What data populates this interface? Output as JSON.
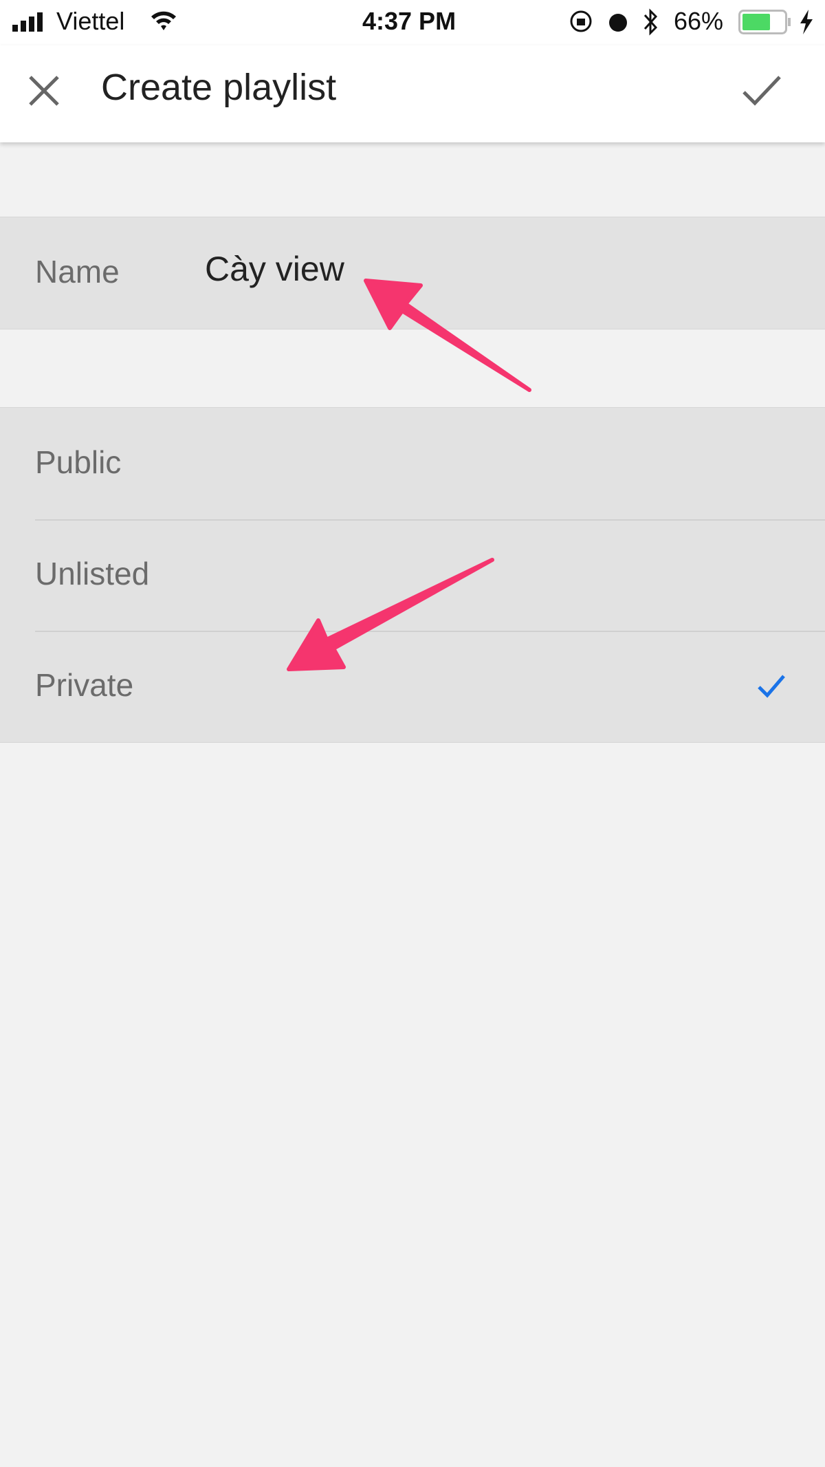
{
  "status_bar": {
    "carrier": "Viettel",
    "time": "4:37 PM",
    "battery": "66%",
    "battery_level": 66,
    "icons": [
      "signal-icon",
      "wifi-icon",
      "orientation-lock-icon",
      "alarm-icon",
      "bluetooth-icon",
      "battery-icon",
      "charging-icon"
    ]
  },
  "header": {
    "title": "Create playlist",
    "close_icon": "close-icon",
    "done_icon": "check-icon"
  },
  "name_field": {
    "label": "Name",
    "value": "Cày view"
  },
  "privacy": {
    "options": [
      {
        "label": "Public",
        "selected": false
      },
      {
        "label": "Unlisted",
        "selected": false
      },
      {
        "label": "Private",
        "selected": true
      }
    ],
    "accent": "#1a73e8"
  },
  "annotation_color": "#f5356e"
}
